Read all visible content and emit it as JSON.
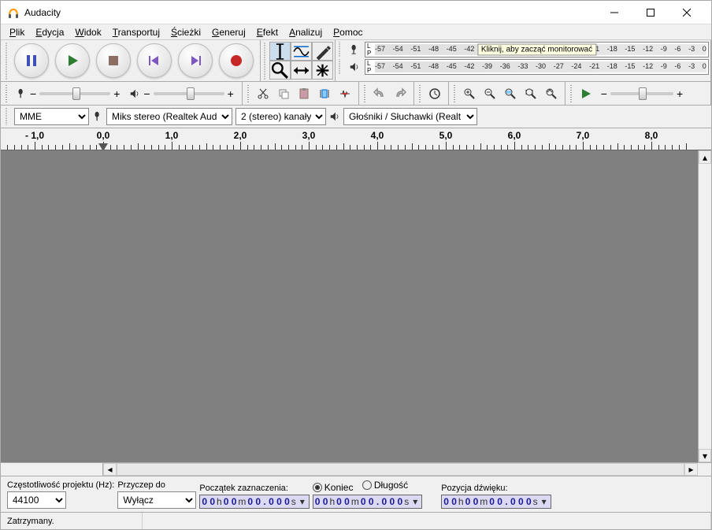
{
  "title": "Audacity",
  "menu": [
    {
      "accel": "P",
      "rest": "lik"
    },
    {
      "accel": "E",
      "rest": "dycja"
    },
    {
      "accel": "W",
      "rest": "idok"
    },
    {
      "accel": "T",
      "rest": "ransportuj"
    },
    {
      "accel": "Ś",
      "rest": "cieżki"
    },
    {
      "accel": "G",
      "rest": "eneruj"
    },
    {
      "accel": "E",
      "rest": "fekt"
    },
    {
      "accel": "A",
      "rest": "nalizuj"
    },
    {
      "accel": "P",
      "rest": "omoc"
    }
  ],
  "meter_scale": [
    "-57",
    "-54",
    "-51",
    "-48",
    "-45",
    "-42",
    "-39",
    "-36",
    "-33",
    "-30",
    "-27",
    "-24",
    "-21",
    "-18",
    "-15",
    "-12",
    "-9",
    "-6",
    "-3",
    "0"
  ],
  "meter_tip": "Kliknij, aby zacząć monitorować",
  "devices": {
    "host": "MME",
    "rec_device": "Miks stereo (Realtek Audio",
    "rec_channels": "2 (stereo) kanały",
    "play_device": "Głośniki / Słuchawki (Realt"
  },
  "timeline_labels": [
    "- 1,0",
    "0,0",
    "1,0",
    "2,0",
    "3,0",
    "4,0",
    "5,0",
    "6,0",
    "7,0",
    "8,0"
  ],
  "selbar": {
    "rate_label": "Częstotliwość projektu (Hz):",
    "rate_value": "44100",
    "snap_label": "Przyczep do",
    "snap_value": "Wyłącz",
    "start_label": "Początek zaznaczenia:",
    "end_label": "Koniec",
    "length_label": "Długość",
    "audiopos_label": "Pozycja dźwięku:",
    "time1": {
      "h": "0 0",
      "m": "0 0",
      "s": "0 0 . 0 0 0"
    },
    "time2": {
      "h": "0 0",
      "m": "0 0",
      "s": "0 0 . 0 0 0"
    },
    "time3": {
      "h": "0 0",
      "m": "0 0",
      "s": "0 0 . 0 0 0"
    }
  },
  "status": "Zatrzymany."
}
